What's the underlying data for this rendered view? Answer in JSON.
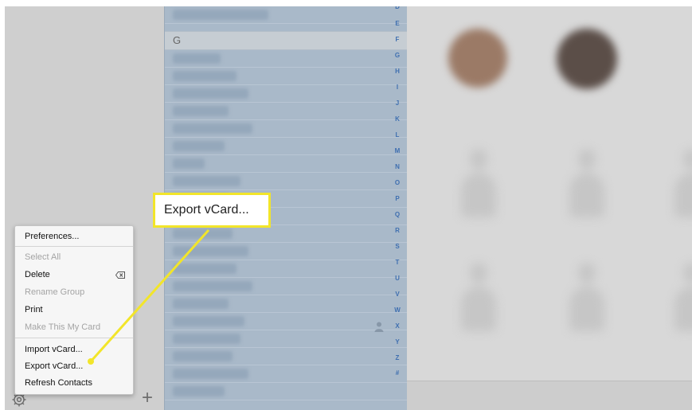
{
  "contact_list": {
    "section_header": "G",
    "index_letters": [
      "D",
      "E",
      "F",
      "G",
      "H",
      "I",
      "J",
      "K",
      "L",
      "M",
      "N",
      "O",
      "P",
      "Q",
      "R",
      "S",
      "T",
      "U",
      "V",
      "W",
      "X",
      "Y",
      "Z",
      "#"
    ]
  },
  "gear_menu": {
    "items": [
      {
        "label": "Preferences...",
        "enabled": true
      },
      {
        "label": "Select All",
        "enabled": false
      },
      {
        "label": "Delete",
        "enabled": true
      },
      {
        "label": "Rename Group",
        "enabled": false
      },
      {
        "label": "Print",
        "enabled": true
      },
      {
        "label": "Make This My Card",
        "enabled": false
      },
      {
        "label": "Import vCard...",
        "enabled": true
      },
      {
        "label": "Export vCard...",
        "enabled": true
      },
      {
        "label": "Refresh Contacts",
        "enabled": true
      }
    ]
  },
  "callout": {
    "text": "Export vCard...",
    "border_color": "#f2e52a"
  },
  "icons": {
    "settings": "gear-icon",
    "add": "plus-icon",
    "delete": "delete-backspace-icon",
    "contact": "person-icon"
  },
  "colors": {
    "index_letters": "#3f6fb0",
    "highlight": "#f2e52a"
  }
}
